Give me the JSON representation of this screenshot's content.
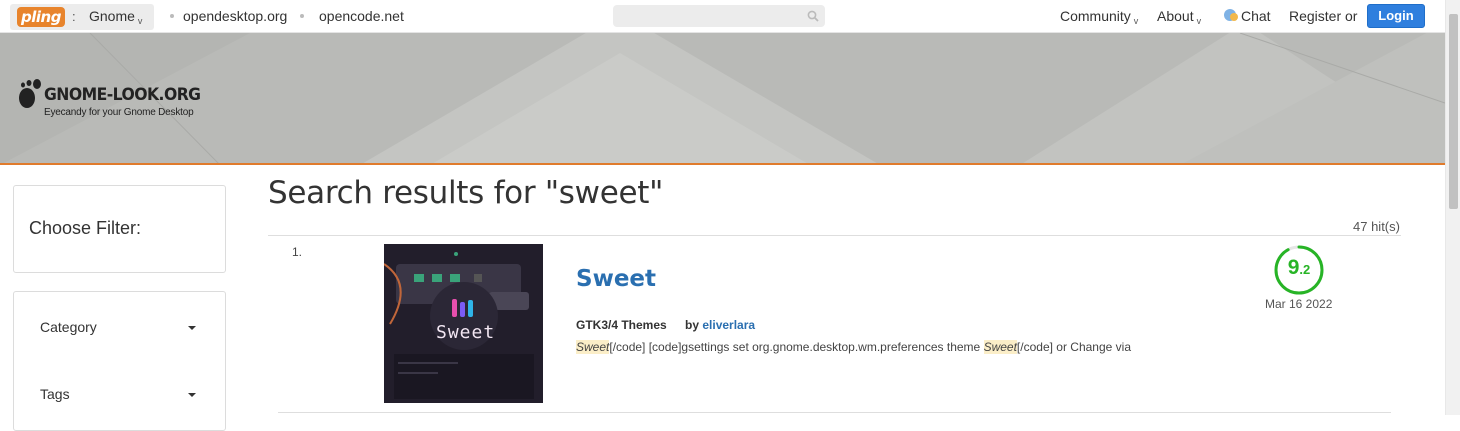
{
  "topbar": {
    "logo_text": "pling",
    "separator": ":",
    "store_name": "Gnome",
    "links": [
      "opendesktop.org",
      "opencode.net"
    ],
    "search_placeholder": "",
    "community_label": "Community",
    "about_label": "About",
    "chat_label": "Chat",
    "register_label": "Register",
    "or_label": "or",
    "login_label": "Login",
    "accent_color": "#2f7fde"
  },
  "header": {
    "site_title": "GNOME-LOOK.ORG",
    "tagline": "Eyecandy for your Gnome Desktop",
    "accent_color": "#e07b2c"
  },
  "sidebar": {
    "filter_title": "Choose Filter:",
    "facets": [
      "Category",
      "Tags"
    ]
  },
  "results": {
    "heading": "Search results for \"sweet\"",
    "hits": "47 hit(s)",
    "items": [
      {
        "rank": "1.",
        "title": "Sweet",
        "thumbnail_text": "Sweet",
        "category": "GTK3/4 Themes",
        "by_label": "by",
        "author": "eliverlara",
        "desc_hl1": "Sweet",
        "desc_mid": "[/code] [code]gsettings set org.gnome.desktop.wm.preferences theme ",
        "desc_hl2": "Sweet",
        "desc_end": "[/code] or Change via",
        "score_major": "9",
        "score_minor": ".2",
        "score_value": 9.2,
        "score_color": "#27b426",
        "date": "Mar 16 2022"
      }
    ]
  }
}
